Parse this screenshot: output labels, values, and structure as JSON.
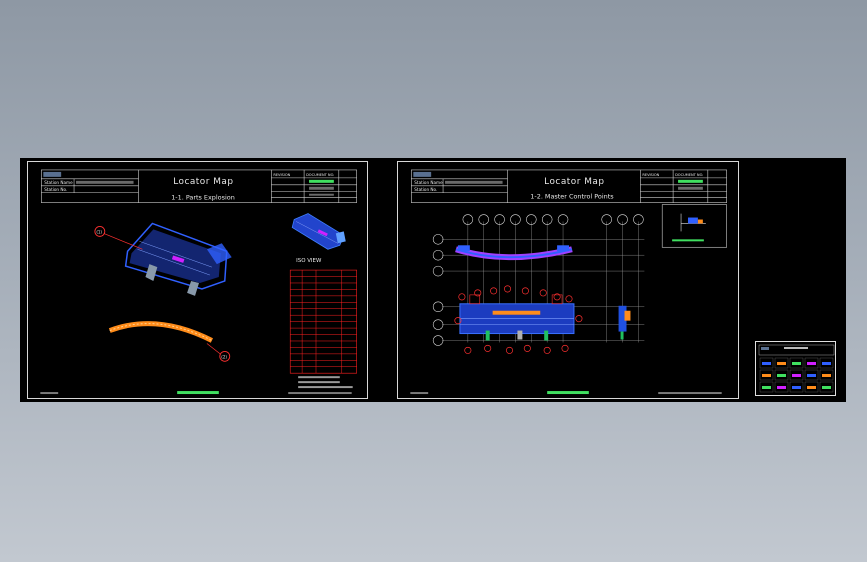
{
  "sheet1": {
    "title": "Locator Map",
    "subtitle": "1-1. Parts Explosion",
    "station_name_label": "Station Name",
    "station_no_label": "Station No.",
    "revision_label": "REVISION",
    "document_no_label": "DOCUMENT NO.",
    "iso_view_label": "ISO VIEW",
    "callout_1": "(1)",
    "callout_2": "(2)"
  },
  "sheet2": {
    "title": "Locator Map",
    "subtitle": "1-2. Master Control Points",
    "station_name_label": "Station Name",
    "station_no_label": "Station No.",
    "revision_label": "REVISION",
    "document_no_label": "DOCUMENT NO."
  },
  "colors": {
    "background": "#000000",
    "part_blue": "#3060ff",
    "part_magenta": "#d020ff",
    "part_orange": "#ff8c1a",
    "callout_red": "#ff3030",
    "table_red": "#ff2020",
    "brand_green": "#40e060",
    "frame_white": "#e0e0e0"
  }
}
